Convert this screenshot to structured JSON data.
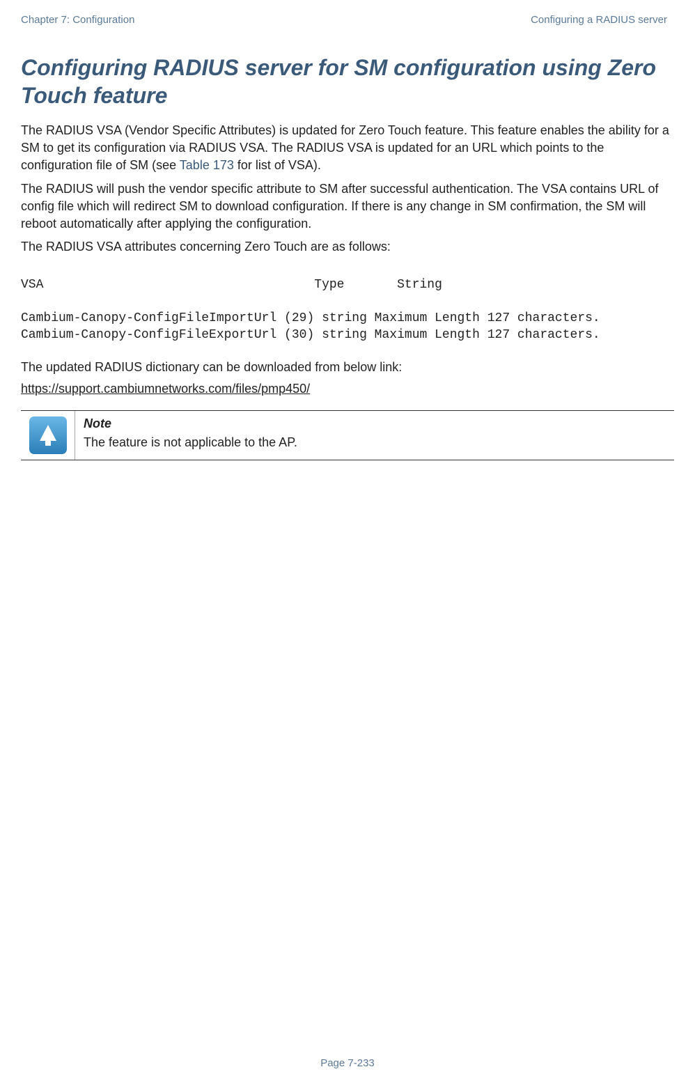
{
  "header": {
    "left": "Chapter 7:  Configuration",
    "right": "Configuring a RADIUS server"
  },
  "heading": "Configuring RADIUS server for SM configuration using Zero Touch feature",
  "paragraphs": {
    "p1_pre": "The RADIUS VSA (Vendor Specific Attributes) is updated for Zero Touch feature. This feature enables the ability for a SM to get its configuration via RADIUS VSA. The RADIUS VSA is updated for an URL which points to the configuration file of SM (see ",
    "p1_link": "Table 173",
    "p1_post": " for list of VSA).",
    "p2": "The RADIUS will push the vendor specific attribute to SM after successful authentication. The VSA contains URL of config file which will redirect SM to download configuration. If there is any change in SM confirmation, the SM will reboot automatically after applying the configuration.",
    "p3": "The RADIUS VSA attributes concerning Zero Touch are as follows:"
  },
  "vsa_header": "VSA                                    Type       String",
  "vsa_rows": {
    "r1": "Cambium-Canopy-ConfigFileImportUrl (29) string  Maximum Length 127 characters.",
    "r2": "Cambium-Canopy-ConfigFileExportUrl (30) string  Maximum Length 127 characters."
  },
  "dict_text": "The updated RADIUS dictionary can be downloaded from below link:",
  "dict_link": "https://support.cambiumnetworks.com/files/pmp450/",
  "note": {
    "title": "Note",
    "body": "The feature is not applicable to the AP."
  },
  "footer": "Page 7-233"
}
